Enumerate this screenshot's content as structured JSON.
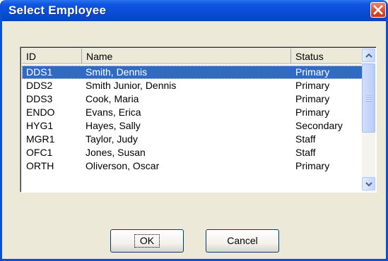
{
  "window": {
    "title": "Select Employee"
  },
  "list": {
    "columns": [
      "ID",
      "Name",
      "Status"
    ],
    "rows": [
      {
        "id": "DDS1",
        "name": "Smith, Dennis",
        "status": "Primary",
        "selected": true
      },
      {
        "id": "DDS2",
        "name": "Smith Junior, Dennis",
        "status": "Primary"
      },
      {
        "id": "DDS3",
        "name": "Cook, Maria",
        "status": "Primary"
      },
      {
        "id": "ENDO",
        "name": "Evans, Erica",
        "status": "Primary"
      },
      {
        "id": "HYG1",
        "name": "Hayes, Sally",
        "status": "Secondary"
      },
      {
        "id": "MGR1",
        "name": "Taylor, Judy",
        "status": "Staff"
      },
      {
        "id": "OFC1",
        "name": "Jones, Susan",
        "status": "Staff"
      },
      {
        "id": "ORTH",
        "name": "Oliverson, Oscar",
        "status": "Primary"
      }
    ]
  },
  "buttons": {
    "ok": "OK",
    "cancel": "Cancel"
  },
  "colors": {
    "selection": "#316ac5",
    "titlebar": "#0a4cd6",
    "dialog_bg": "#ece9d8"
  },
  "icons": {
    "close": "close-icon",
    "scroll_up": "chevron-up-icon",
    "scroll_down": "chevron-down-icon"
  }
}
